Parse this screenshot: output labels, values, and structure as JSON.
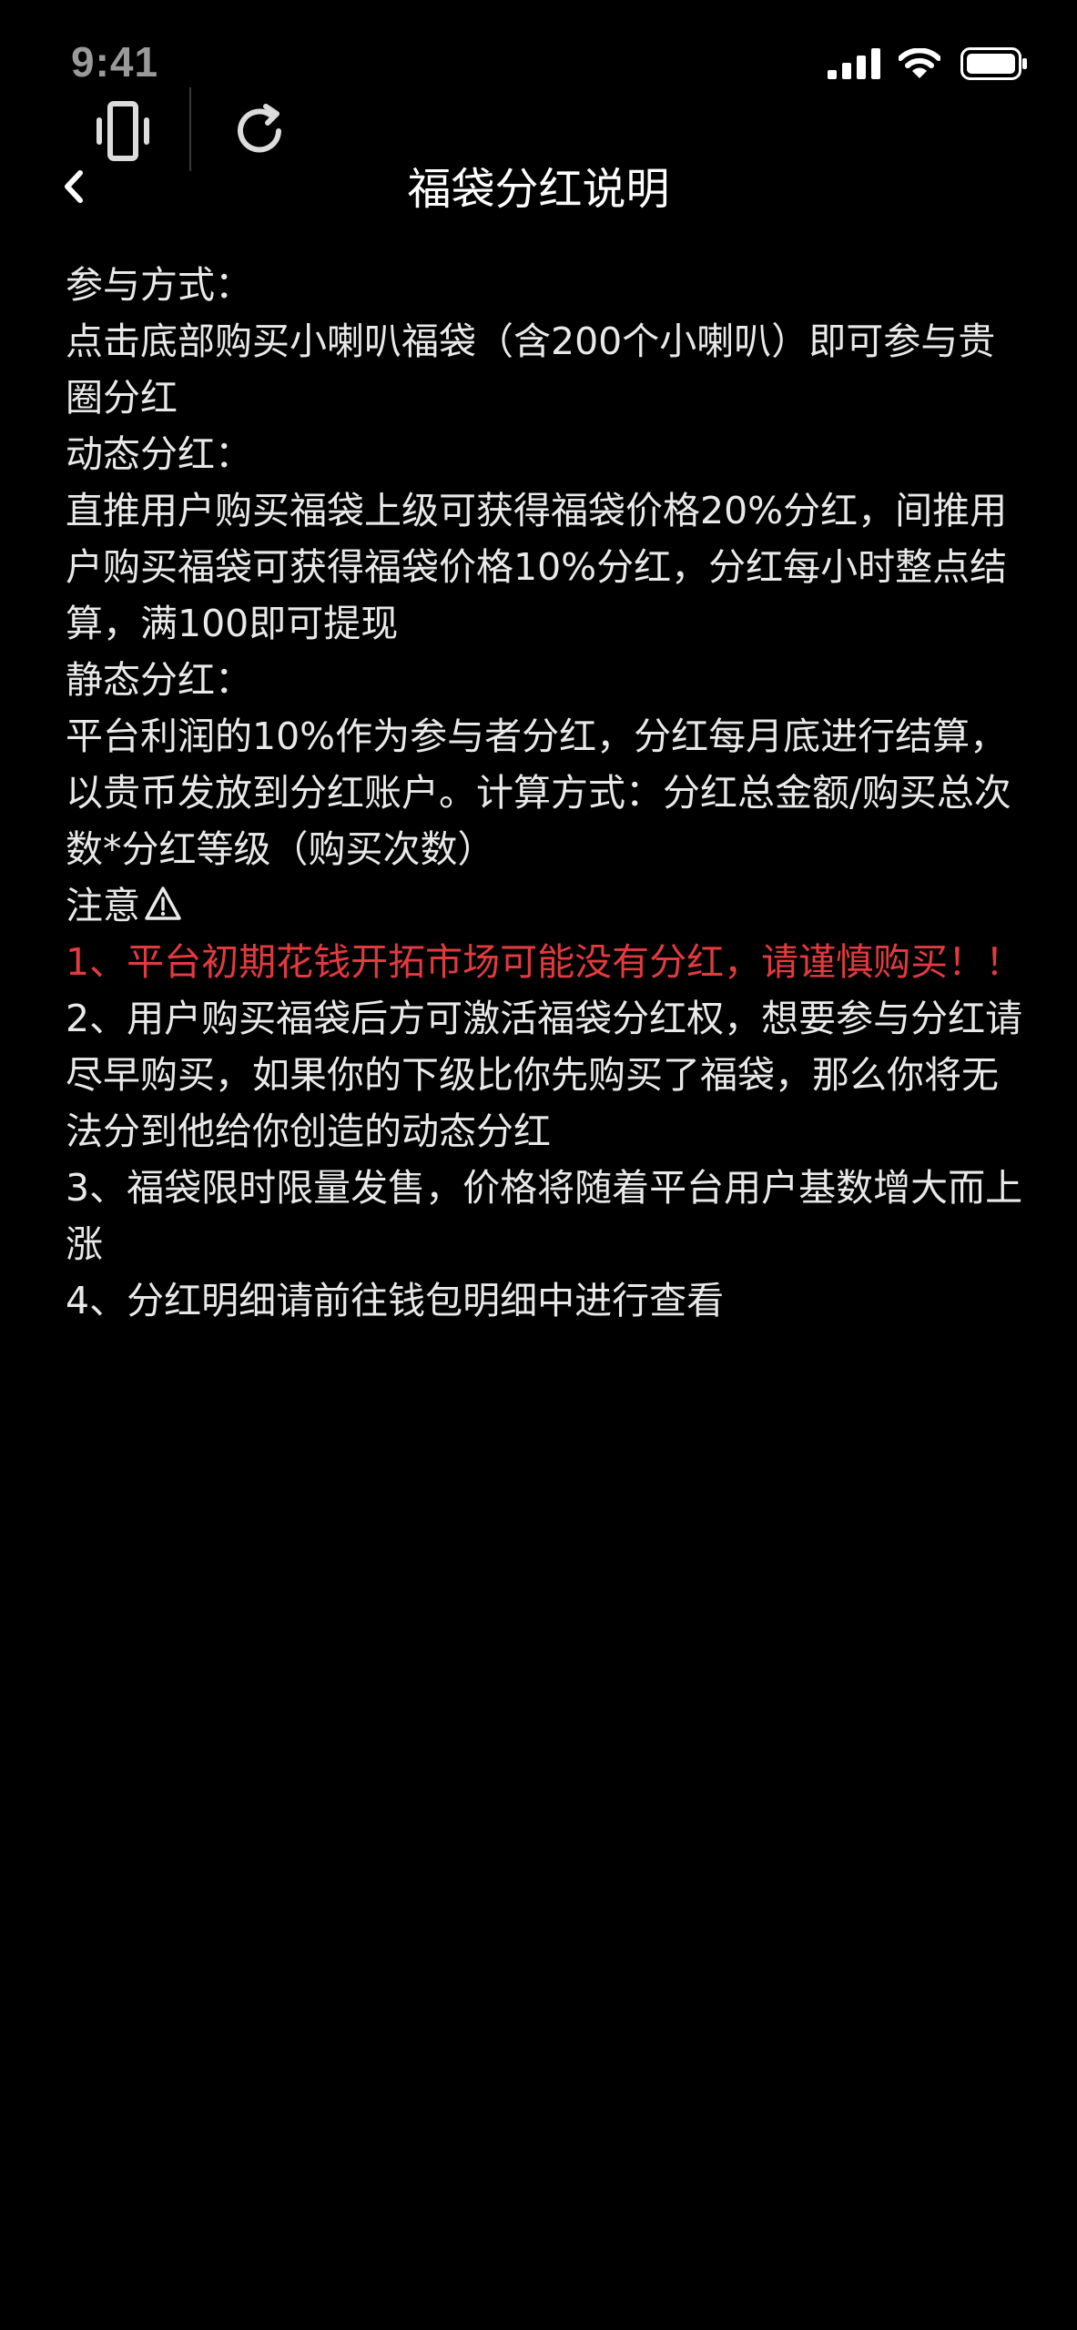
{
  "status_bar": {
    "time": "9:41"
  },
  "header": {
    "title": "福袋分红说明"
  },
  "content": {
    "participation_heading": "参与方式：",
    "participation_text": "点击底部购买小喇叭福袋（含200个小喇叭）即可参与贵圈分红",
    "dynamic_heading": "动态分红：",
    "dynamic_text": "直推用户购买福袋上级可获得福袋价格20%分红，间推用户购买福袋可获得福袋价格10%分红，分红每小时整点结算，满100即可提现",
    "static_heading": "静态分红：",
    "static_text": "平台利润的10%作为参与者分红，分红每月底进行结算，以贵币发放到分红账户。计算方式：分红总金额/购买总次数*分红等级（购买次数）",
    "notice_heading": "注意",
    "notice_items": [
      "1、平台初期花钱开拓市场可能没有分红，请谨慎购买！！",
      "2、用户购买福袋后方可激活福袋分红权，想要参与分红请尽早购买，如果你的下级比你先购买了福袋，那么你将无法分到他给你创造的动态分红",
      "3、福袋限时限量发售，价格将随着平台用户基数增大而上涨",
      "4、分红明细请前往钱包明细中进行查看"
    ]
  },
  "colors": {
    "background": "#000000",
    "text": "#e9e9e9",
    "warning": "#e23a3f"
  },
  "icons": {
    "signal": "signal-icon",
    "wifi": "wifi-icon",
    "battery": "battery-icon",
    "vibrate": "vibrate-icon",
    "refresh": "refresh-icon",
    "back": "back-icon",
    "warning": "warning-icon"
  }
}
